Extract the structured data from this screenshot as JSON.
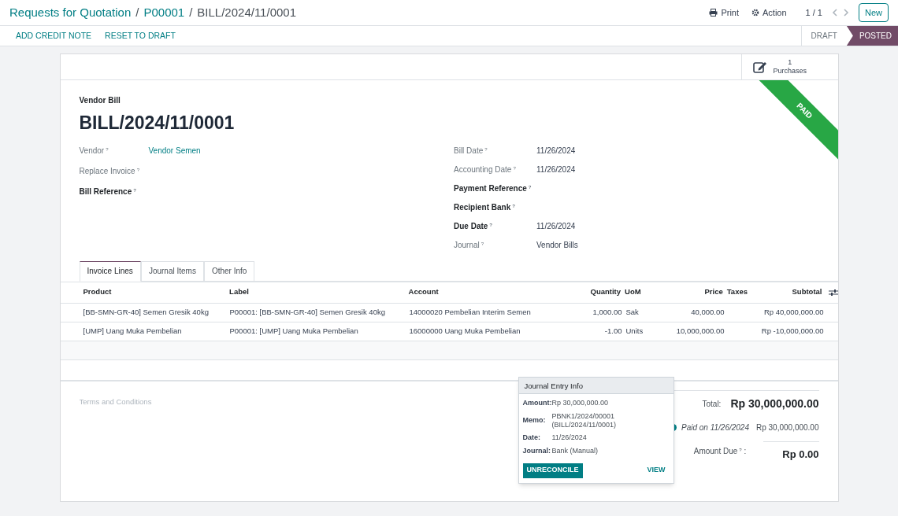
{
  "breadcrumb": [
    "Requests for Quotation",
    "P00001",
    "BILL/2024/11/0001"
  ],
  "breadcrumb_separator": "/",
  "toolbar": {
    "print": "Print",
    "action": "Action",
    "pager": "1 / 1",
    "new": "New"
  },
  "actions": [
    "ADD CREDIT NOTE",
    "RESET TO DRAFT"
  ],
  "stages": [
    {
      "label": "DRAFT",
      "selected": false
    },
    {
      "label": "POSTED",
      "selected": true
    }
  ],
  "smart_button": {
    "count": "1",
    "label": "Purchases"
  },
  "ribbon": "PAID",
  "document_type": "Vendor Bill",
  "document_name": "BILL/2024/11/0001",
  "left_fields": [
    {
      "label": "Vendor",
      "help": "?",
      "value": "Vendor Semen",
      "required": false,
      "link": true
    },
    {
      "label": "Replace Invoice",
      "help": "?",
      "required": false
    },
    {
      "label": "Bill Reference",
      "help": "?",
      "required": true
    }
  ],
  "right_fields": [
    {
      "label": "Bill Date",
      "help": "?",
      "value": "11/26/2024",
      "required": false,
      "link": false
    },
    {
      "label": "Accounting Date",
      "help": "?",
      "value": "11/26/2024",
      "required": false,
      "link": false
    },
    {
      "label": "Payment Reference",
      "help": "?",
      "required": true
    },
    {
      "label": "Recipient Bank",
      "help": "?",
      "required": true
    },
    {
      "label": "Due Date",
      "help": "?",
      "value": "11/26/2024",
      "required": true,
      "link": false
    },
    {
      "label": "Journal",
      "help": "?",
      "value": "Vendor Bills",
      "required": false,
      "link": false
    }
  ],
  "tabs": [
    {
      "label": "Invoice Lines",
      "selected": true
    },
    {
      "label": "Journal Items",
      "selected": false
    },
    {
      "label": "Other Info",
      "selected": false
    }
  ],
  "table": {
    "columns": [
      "Product",
      "Label",
      "Account",
      "Quantity",
      "UoM",
      "Price",
      "Taxes",
      "Subtotal"
    ],
    "rows": [
      [
        "[BB-SMN-GR-40] Semen Gresik 40kg",
        "P00001: [BB-SMN-GR-40] Semen Gresik 40kg",
        "14000020 Pembelian Interim Semen",
        "1,000.00",
        "Sak",
        "40,000.00",
        "",
        "Rp 40,000,000.00"
      ],
      [
        "[UMP] Uang Muka Pembelian",
        "P00001: [UMP] Uang Muka Pembelian",
        "16000000 Uang Muka Pembelian",
        "-1.00",
        "Units",
        "10,000,000.00",
        "",
        "Rp -10,000,000.00"
      ]
    ]
  },
  "terms_placeholder": "Terms and Conditions",
  "totals": {
    "total_label": "Total:",
    "total": "Rp 30,000,000.00",
    "paid_label": "Paid on 11/26/2024",
    "paid_amount": "Rp 30,000,000.00",
    "due_label": "Amount Due",
    "due_help": "?",
    "due_colon": ":",
    "due": "Rp 0.00"
  },
  "popover": {
    "title": "Journal Entry Info",
    "fields": [
      {
        "label": "Amount:",
        "value": "Rp 30,000,000.00"
      },
      {
        "label": "Memo:",
        "value": "PBNK1/2024/00001 (BILL/2024/11/0001)"
      },
      {
        "label": "Date:",
        "value": "11/26/2024"
      },
      {
        "label": "Journal:",
        "value": "Bank (Manual)"
      }
    ],
    "unreconcile": "UNRECONCILE",
    "view": "VIEW"
  }
}
